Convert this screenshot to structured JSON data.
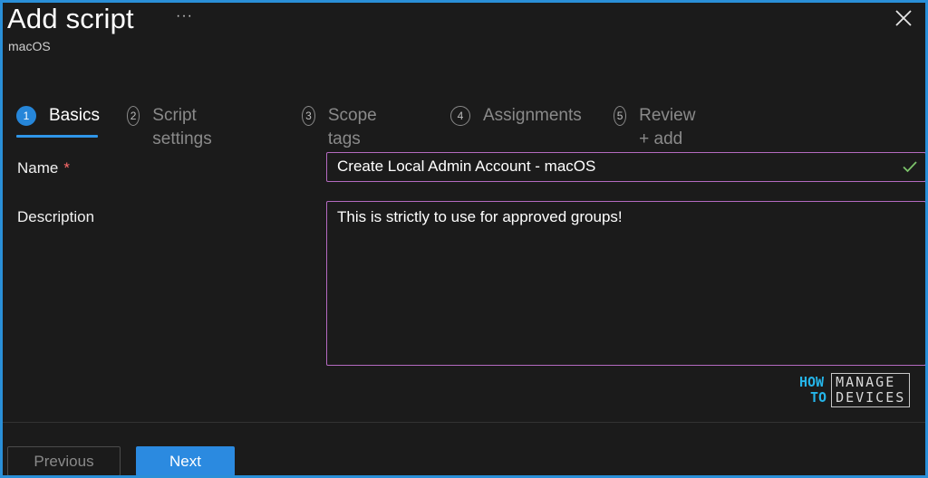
{
  "header": {
    "title": "Add script",
    "more_label": "···",
    "subtitle": "macOS"
  },
  "icons": {
    "close": "close-icon",
    "check": "checkmark-icon"
  },
  "steps": [
    {
      "number": "1",
      "label": "Basics",
      "active": true
    },
    {
      "number": "2",
      "label": "Script settings",
      "active": false
    },
    {
      "number": "3",
      "label": "Scope tags",
      "active": false
    },
    {
      "number": "4",
      "label": "Assignments",
      "active": false
    },
    {
      "number": "5",
      "label": "Review + add",
      "active": false
    }
  ],
  "form": {
    "name_label": "Name",
    "name_required": "*",
    "name_value": "Create Local Admin Account - macOS",
    "description_label": "Description",
    "description_value": "This is strictly to use for approved groups!"
  },
  "watermark": {
    "how": "HOW",
    "to": "TO",
    "manage": "MANAGE",
    "devices": "DEVICES"
  },
  "footer": {
    "previous_label": "Previous",
    "next_label": "Next"
  },
  "colors": {
    "accent": "#2b8ae0",
    "input_border": "#b46ac0",
    "valid_check": "#7cc36b",
    "required": "#ff6b6b"
  }
}
